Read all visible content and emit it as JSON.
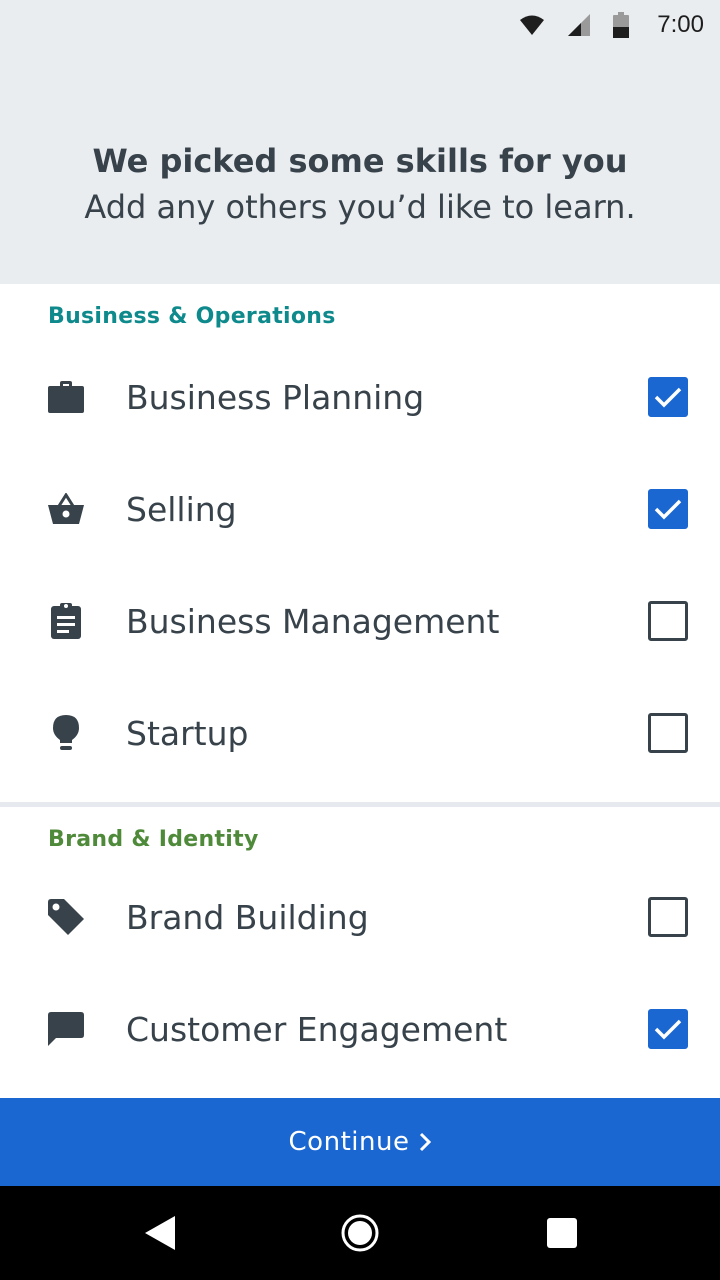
{
  "status_bar": {
    "time": "7:00"
  },
  "header": {
    "title": "We picked some skills for you",
    "subtitle": "Add any others you’d like to learn."
  },
  "sections": [
    {
      "name": "Business & Operations",
      "color": "#0f8a8c",
      "items": [
        {
          "label": "Business Planning",
          "icon": "briefcase-icon",
          "checked": true
        },
        {
          "label": "Selling",
          "icon": "basket-icon",
          "checked": true
        },
        {
          "label": "Business Management",
          "icon": "clipboard-icon",
          "checked": false
        },
        {
          "label": "Startup",
          "icon": "lightbulb-icon",
          "checked": false
        }
      ]
    },
    {
      "name": "Brand & Identity",
      "color": "#4f8a3a",
      "items": [
        {
          "label": "Brand Building",
          "icon": "tag-icon",
          "checked": false
        },
        {
          "label": "Customer Engagement",
          "icon": "chat-icon",
          "checked": true
        }
      ]
    }
  ],
  "continue_button": {
    "label": "Continue"
  },
  "colors": {
    "accent": "#1b67d2",
    "header_bg": "#eaedf0",
    "text": "#37424a"
  }
}
